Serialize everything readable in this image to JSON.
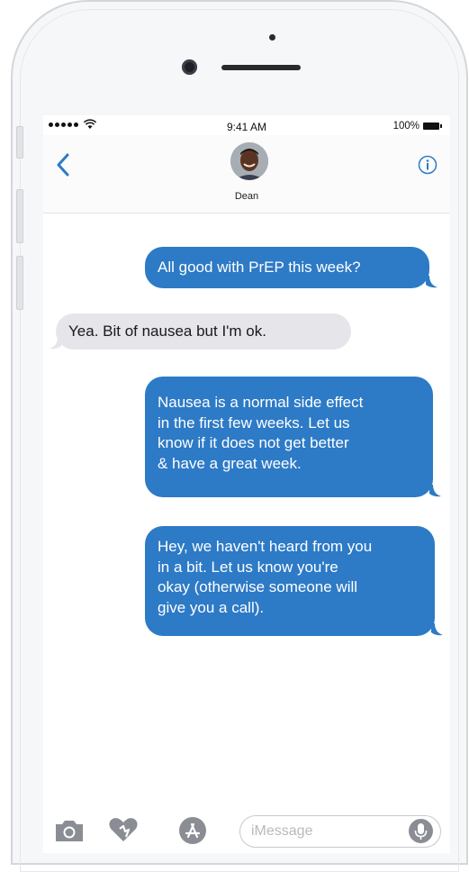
{
  "status_bar": {
    "time": "9:41 AM",
    "battery_percent": "100%",
    "signal_dots": 5,
    "wifi_icon": "wifi-icon"
  },
  "header": {
    "contact_name": "Dean",
    "back_icon": "chevron-left-icon",
    "info_icon": "info-icon",
    "accent_color": "#2d7ac6"
  },
  "messages": [
    {
      "direction": "outgoing",
      "text": "All good with PrEP this week?"
    },
    {
      "direction": "incoming",
      "text": "Yea. Bit of nausea but I'm ok."
    },
    {
      "direction": "outgoing",
      "text": "Nausea is a normal side effect\nin the first few weeks. Let us\nknow if it does not get better\n& have a great week."
    },
    {
      "direction": "outgoing",
      "text": "Hey, we haven't heard from you\nin a bit. Let us know you're\nokay (otherwise someone will\ngive you a call)."
    }
  ],
  "colors": {
    "outgoing_bubble": "#2d7ac6",
    "incoming_bubble": "#e5e5ea"
  },
  "toolbar": {
    "camera_icon": "camera-icon",
    "digital_touch_icon": "digital-touch-icon",
    "app_store_icon": "app-store-icon",
    "input_placeholder": "iMessage",
    "mic_icon": "microphone-icon"
  }
}
